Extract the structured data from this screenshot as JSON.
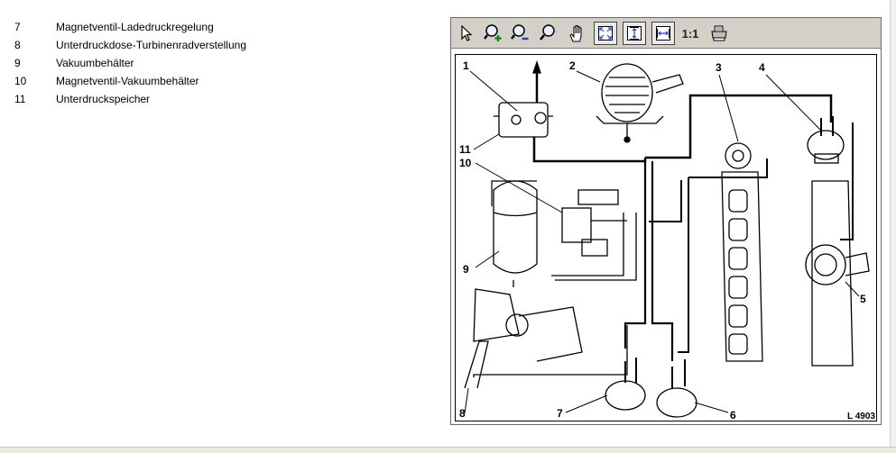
{
  "legend": [
    {
      "number": "7",
      "label": "Magnetventil-Ladedruckregelung"
    },
    {
      "number": "8",
      "label": "Unterdruckdose-Turbinenradverstellung"
    },
    {
      "number": "9",
      "label": "Vakuumbehälter"
    },
    {
      "number": "10",
      "label": "Magnetventil-Vakuumbehälter"
    },
    {
      "number": "11",
      "label": "Unterdruckspeicher"
    }
  ],
  "toolbar": {
    "one_to_one_label": "1:1",
    "icons": [
      "pointer-icon",
      "zoom-in-icon",
      "zoom-out-icon",
      "zoom-icon",
      "hand-pan-icon",
      "fit-page-icon",
      "fit-height-icon",
      "fit-width-icon",
      "one-to-one-icon",
      "print-icon"
    ]
  },
  "figure": {
    "callouts": [
      "1",
      "2",
      "3",
      "4",
      "5",
      "6",
      "7",
      "8",
      "9",
      "10",
      "11"
    ],
    "code": "L 4903"
  }
}
